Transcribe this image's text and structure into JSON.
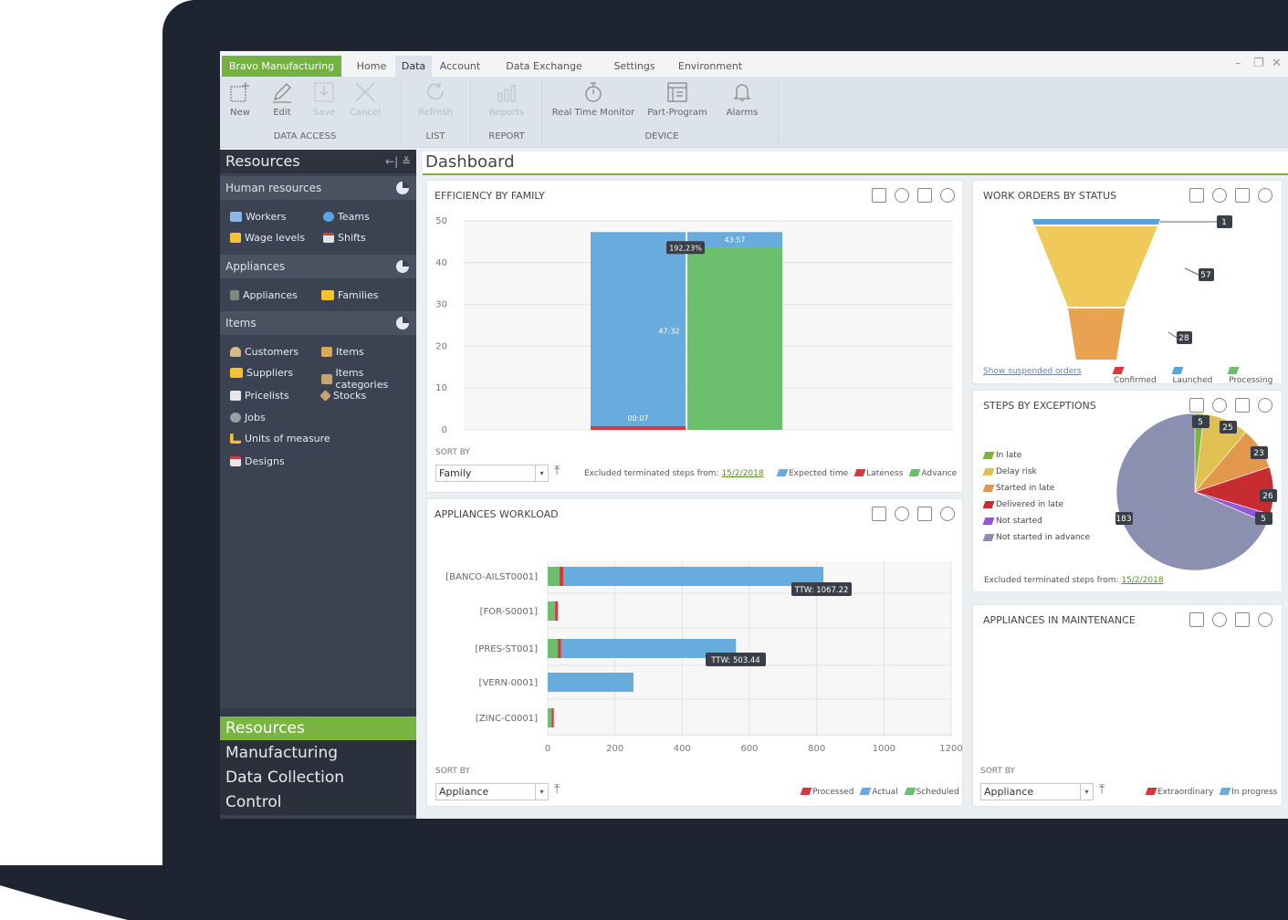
{
  "tabs": {
    "brand": "Bravo Manufacturing",
    "items": [
      "Home",
      "Data",
      "Account",
      "Data Exchange",
      "Settings",
      "Environment"
    ],
    "active": "Data"
  },
  "ribbon": {
    "new": "New",
    "edit": "Edit",
    "save": "Save",
    "cancel": "Cancel",
    "refresh": "Refresh",
    "reports": "Reports",
    "rtm": "Real Time Monitor",
    "partprog": "Part-Program",
    "alarms": "Alarms",
    "groups": {
      "data_access": "DATA ACCESS",
      "list": "LIST",
      "report": "REPORT",
      "device": "DEVICE"
    }
  },
  "sidebar": {
    "title": "Resources",
    "sections": {
      "human": {
        "label": "Human resources",
        "items": [
          "Workers",
          "Teams",
          "Wage levels",
          "Shifts"
        ]
      },
      "appliances": {
        "label": "Appliances",
        "items": [
          "Appliances",
          "Families"
        ]
      },
      "items": {
        "label": "Items",
        "items": [
          "Customers",
          "Items",
          "Suppliers",
          "Items categories",
          "Pricelists",
          "Stocks",
          "Jobs",
          "Units of measure",
          "Designs"
        ]
      }
    },
    "modules": [
      "Resources",
      "Manufacturing",
      "Data Collection",
      "Control"
    ],
    "active_module": "Resources"
  },
  "dashboard": {
    "title": "Dashboard"
  },
  "efficiency": {
    "title": "EFFICIENCY BY FAMILY",
    "sort_label": "SORT BY",
    "sort_value": "Family",
    "excluded_text": "Excluded terminated steps from:",
    "excluded_date": "15/2/2018",
    "legend": [
      "Expected time",
      "Lateness",
      "Advance"
    ],
    "tooltip": "192,23%"
  },
  "workorders": {
    "title": "WORK ORDERS BY STATUS",
    "link": "Show suspended orders",
    "legend": [
      "Confirmed",
      "Launched",
      "Processing"
    ]
  },
  "steps": {
    "title": "STEPS BY EXCEPTIONS",
    "legend": [
      "In late",
      "Delay risk",
      "Started in late",
      "Delivered in late",
      "Not started",
      "Not started in advance"
    ],
    "excluded_text": "Excluded terminated steps from:",
    "excluded_date": "15/2/2018"
  },
  "workload": {
    "title": "APPLIANCES WORKLOAD",
    "sort_label": "SORT BY",
    "sort_value": "Appliance",
    "legend": [
      "Processed",
      "Actual",
      "Scheduled"
    ],
    "tooltips": [
      "TTW: 1067.22",
      "TTW: 503.44"
    ]
  },
  "maintenance": {
    "title": "APPLIANCES IN MAINTENANCE",
    "sort_label": "SORT BY",
    "sort_value": "Appliance",
    "legend": [
      "Extraordinary",
      "In progress"
    ]
  },
  "colors": {
    "green": "#7ab441",
    "blue": "#68abdd",
    "red": "#d9363e",
    "chart_green": "#6cbf6c",
    "funnel_blue": "#55a5de",
    "funnel_yellow": "#efc95a",
    "funnel_orange": "#e9a24f",
    "pie_gray": "#8b90b0",
    "pie_green": "#7bb33c",
    "pie_yellow": "#e0c050",
    "pie_orange": "#e2984a",
    "pie_red": "#c62c30",
    "pie_purple": "#9458d6"
  },
  "chart_data": [
    {
      "type": "bar",
      "title": "EFFICIENCY BY FAMILY",
      "ylim": [
        0,
        50
      ],
      "yticks": [
        0,
        10,
        20,
        30,
        40,
        50
      ],
      "series": [
        {
          "name": "Expected time",
          "values": [
            47.32
          ]
        },
        {
          "name": "Lateness",
          "values": [
            0.07
          ]
        },
        {
          "name": "Advance",
          "values": [
            43.57
          ]
        }
      ],
      "data_labels": [
        "00:07",
        "47:32",
        "43:57"
      ]
    },
    {
      "type": "bar",
      "title": "WORK ORDERS BY STATUS",
      "categories": [
        "Launched",
        "Confirmed",
        "Processing"
      ],
      "values": [
        1,
        57,
        28
      ]
    },
    {
      "type": "pie",
      "title": "STEPS BY EXCEPTIONS",
      "categories": [
        "In late",
        "Delay risk",
        "Started in late",
        "Delivered in late",
        "Not started",
        "Not started in advance"
      ],
      "values": [
        5,
        25,
        23,
        26,
        5,
        183
      ]
    },
    {
      "type": "bar",
      "title": "APPLIANCES WORKLOAD",
      "categories": [
        "[BANCO-AILST0001]",
        "[FOR-S0001]",
        "[PRES-ST001]",
        "[VERN-0001]",
        "[ZINC-C0001]"
      ],
      "xlim": [
        0,
        1200
      ],
      "xticks": [
        0,
        200,
        400,
        600,
        800,
        1000,
        1200
      ],
      "series": [
        {
          "name": "Scheduled",
          "values": [
            35,
            22,
            30,
            0,
            12
          ]
        },
        {
          "name": "Processed",
          "values": [
            12,
            8,
            10,
            0,
            6
          ]
        },
        {
          "name": "Actual",
          "values": [
            820,
            0,
            560,
            255,
            0
          ]
        }
      ]
    }
  ]
}
